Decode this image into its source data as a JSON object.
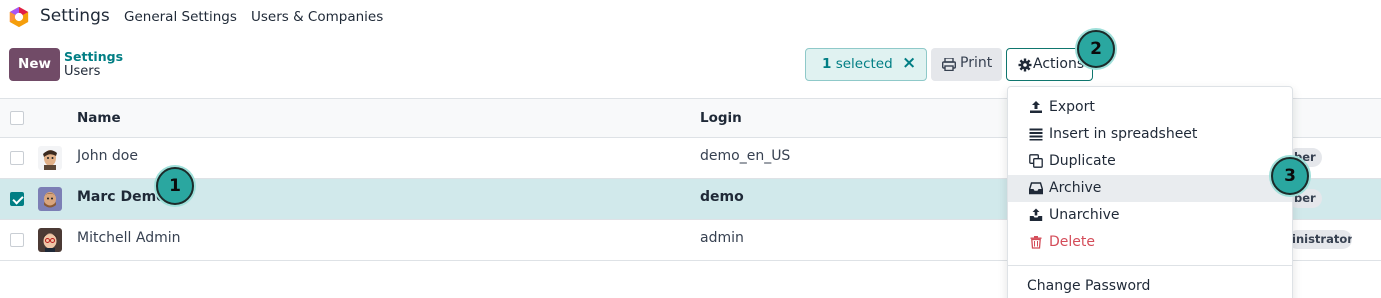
{
  "navbar": {
    "app_name": "Settings",
    "menu": [
      "General Settings",
      "Users & Companies"
    ]
  },
  "control_panel": {
    "new_label": "New",
    "breadcrumb_parent": "Settings",
    "breadcrumb_current": "Users",
    "selected_count": "1",
    "selected_suffix": " selected",
    "print_label": "Print",
    "actions_label": "Actions"
  },
  "table": {
    "headers": {
      "name": "Name",
      "login": "Login"
    },
    "rows": [
      {
        "name": "John doe",
        "login": "demo_en_US",
        "tag": "ber",
        "checked": false
      },
      {
        "name": "Marc Demo",
        "login": "demo",
        "tag": "ber",
        "checked": true
      },
      {
        "name": "Mitchell Admin",
        "login": "admin",
        "tag": "inistrator",
        "checked": false
      }
    ]
  },
  "actions_menu": {
    "items": [
      {
        "label": "Export",
        "icon": "upload-icon"
      },
      {
        "label": "Insert in spreadsheet",
        "icon": "list-icon"
      },
      {
        "label": "Duplicate",
        "icon": "copy-icon"
      },
      {
        "label": "Archive",
        "icon": "inbox-icon"
      },
      {
        "label": "Unarchive",
        "icon": "unarchive-icon"
      },
      {
        "label": "Delete",
        "icon": "trash-icon"
      }
    ],
    "change_password": "Change Password"
  },
  "step_badges": [
    "1",
    "2",
    "3"
  ],
  "colors": {
    "brand": "#714b67",
    "accent": "#017e84",
    "danger": "#d44c59",
    "selected_row": "#d1e9eb"
  }
}
